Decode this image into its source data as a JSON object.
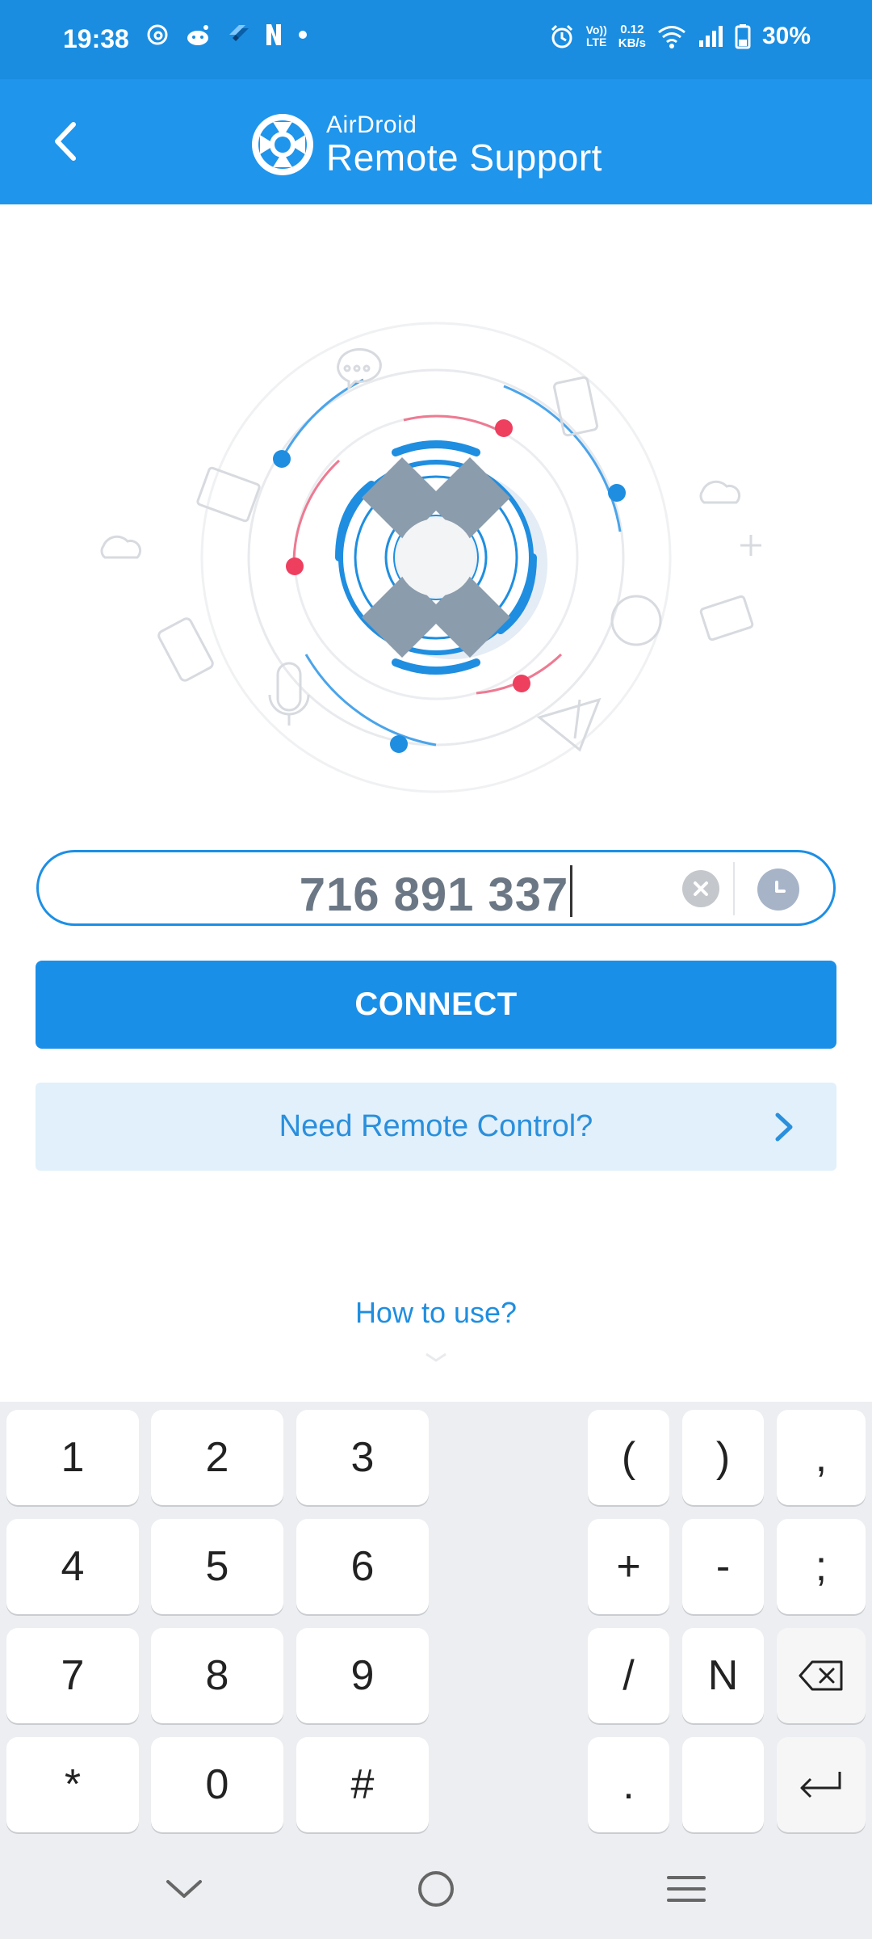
{
  "status_bar": {
    "time": "19:38",
    "volte_top": "Vo))",
    "volte_bottom": "LTE",
    "speed_value": "0.12",
    "speed_unit": "KB/s",
    "battery": "30%",
    "left_icons": [
      "threads-icon",
      "reddit-icon",
      "flutter-icon",
      "netflix-icon",
      "dot-icon"
    ],
    "right_icons": [
      "alarm-icon",
      "volte-icon",
      "speed-indicator",
      "wifi-icon",
      "signal-icon",
      "battery-icon"
    ]
  },
  "app_bar": {
    "brand_top": "AirDroid",
    "brand_bottom": "Remote Support",
    "back_icon": "back-chevron-icon"
  },
  "connection": {
    "id_value": "716 891 337",
    "connect_label": "CONNECT",
    "need_remote_label": "Need Remote Control?",
    "how_to_label": "How to use?"
  },
  "keyboard": {
    "left_keys": [
      [
        "1",
        "2",
        "3"
      ],
      [
        "4",
        "5",
        "6"
      ],
      [
        "7",
        "8",
        "9"
      ],
      [
        "*",
        "0",
        "#"
      ]
    ],
    "right_keys": [
      [
        "(",
        ")",
        ","
      ],
      [
        "+",
        "-",
        ";"
      ],
      [
        "/",
        "N",
        "backspace"
      ],
      [
        ".",
        "space",
        "enter"
      ]
    ]
  },
  "colors": {
    "status_bar": "#1a8de0",
    "app_bar": "#1f95ec",
    "accent": "#1a8fe8",
    "accent_light": "#e1f0fb",
    "dot_red": "#ee3f5f"
  }
}
